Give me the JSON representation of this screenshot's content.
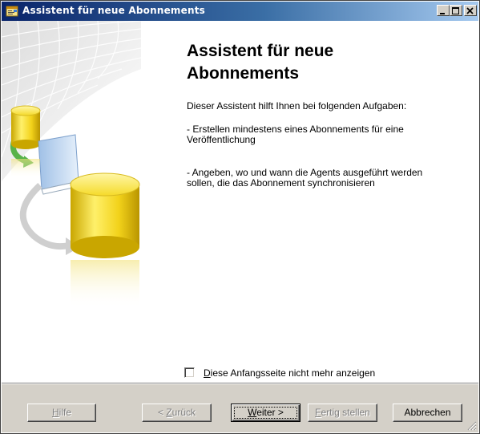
{
  "window": {
    "title": "Assistent für neue Abonnements"
  },
  "page": {
    "heading": "Assistent für neue Abonnements",
    "intro": "Dieser Assistent hilft Ihnen bei folgenden Aufgaben:",
    "bullets": [
      "- Erstellen mindestens eines Abonnements für eine Veröffentlichung",
      "- Angeben, wo und wann die Agents ausgeführt werden sollen, die das Abonnement synchronisieren"
    ]
  },
  "checkbox": {
    "label_accel": "D",
    "label_rest": "iese Anfangsseite nicht mehr anzeigen",
    "checked": false
  },
  "buttons": {
    "help": {
      "accel": "H",
      "rest": "ilfe",
      "enabled": false
    },
    "back": {
      "prefix": "< ",
      "accel": "Z",
      "rest": "urück",
      "enabled": false
    },
    "next": {
      "accel": "W",
      "rest": "eiter >",
      "enabled": true
    },
    "finish": {
      "accel": "F",
      "rest": "ertig stellen",
      "enabled": false
    },
    "cancel": {
      "label": "Abbrechen",
      "enabled": true
    }
  },
  "icons": {
    "app": "wizard-app-icon",
    "minimize": "minimize-icon",
    "maximize": "maximize-icon",
    "close": "close-icon",
    "illustration": "database-publication-illustration",
    "grip": "resize-grip-icon"
  },
  "colors": {
    "titlebar_start": "#0a246a",
    "titlebar_end": "#a6caf0",
    "dialog_face": "#d4d0c8",
    "cylinder": "#f2d21a"
  }
}
